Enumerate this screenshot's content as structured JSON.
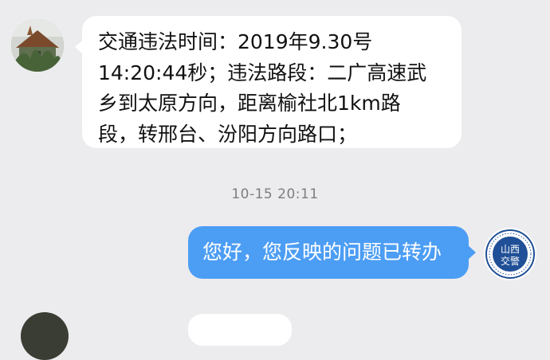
{
  "conversation": {
    "incoming": {
      "lines": [
        "交通违法时间：2019年9.30号",
        "14:20:44秒；违法路段：二广高速武",
        "乡到太原方向，距离榆社北1km路",
        "段，转邢台、汾阳方向路口；"
      ]
    },
    "timestamp": "10-15 20:11",
    "outgoing": {
      "text": "您好，您反映的问题已转办"
    },
    "agent_badge": {
      "line1": "山西",
      "line2": "交警"
    }
  },
  "colors": {
    "background": "#ececee",
    "incoming_bubble": "#ffffff",
    "outgoing_bubble": "#4c9df4",
    "badge_blue": "#1f4f96",
    "timestamp_text": "#7d7d80"
  }
}
